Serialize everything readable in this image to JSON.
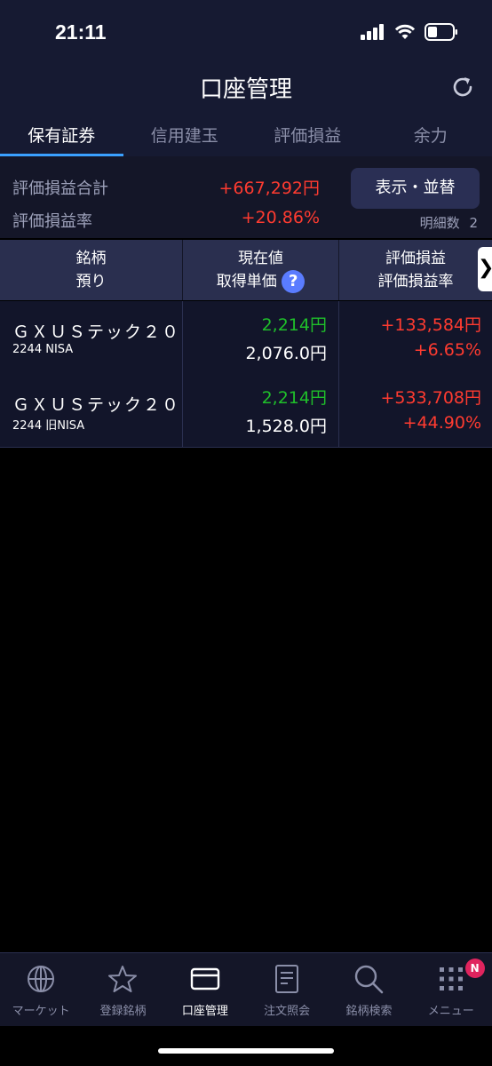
{
  "status": {
    "time": "21:11"
  },
  "header": {
    "title": "口座管理"
  },
  "tabs": [
    {
      "label": "保有証券",
      "active": true
    },
    {
      "label": "信用建玉",
      "active": false
    },
    {
      "label": "評価損益",
      "active": false
    },
    {
      "label": "余力",
      "active": false
    }
  ],
  "summary": {
    "total_label": "評価損益合計",
    "total_value": "+667,292円",
    "rate_label": "評価損益率",
    "rate_value": "+20.86%",
    "display_button": "表示・並替",
    "detail_count_label": "明細数",
    "detail_count": "2"
  },
  "table": {
    "col1_line1": "銘柄",
    "col1_line2": "預り",
    "col2_line1": "現在値",
    "col2_line2": "取得単価",
    "col3_line1": "評価損益",
    "col3_line2": "評価損益率",
    "help_icon": "?",
    "next_icon": "❯"
  },
  "rows": [
    {
      "name": "ＧＸＵＳテック２０",
      "code_account": "2244 NISA",
      "current": "2,214円",
      "cost": "2,076.0円",
      "pl": "+133,584円",
      "pl_rate": "+6.65%"
    },
    {
      "name": "ＧＸＵＳテック２０",
      "code_account": "2244 旧NISA",
      "current": "2,214円",
      "cost": "1,528.0円",
      "pl": "+533,708円",
      "pl_rate": "+44.90%"
    }
  ],
  "nav": [
    {
      "label": "マーケット",
      "icon": "globe-icon",
      "active": false
    },
    {
      "label": "登録銘柄",
      "icon": "star-icon",
      "active": false
    },
    {
      "label": "口座管理",
      "icon": "card-icon",
      "active": true
    },
    {
      "label": "注文照会",
      "icon": "document-icon",
      "active": false
    },
    {
      "label": "銘柄検索",
      "icon": "search-icon",
      "active": false
    },
    {
      "label": "メニュー",
      "icon": "grid-menu-icon",
      "active": false,
      "badge": "N"
    }
  ],
  "colors": {
    "positive": "#ff3b30",
    "price": "#1fbf2a",
    "accent": "#3aa0ff",
    "background": "#161a32"
  }
}
